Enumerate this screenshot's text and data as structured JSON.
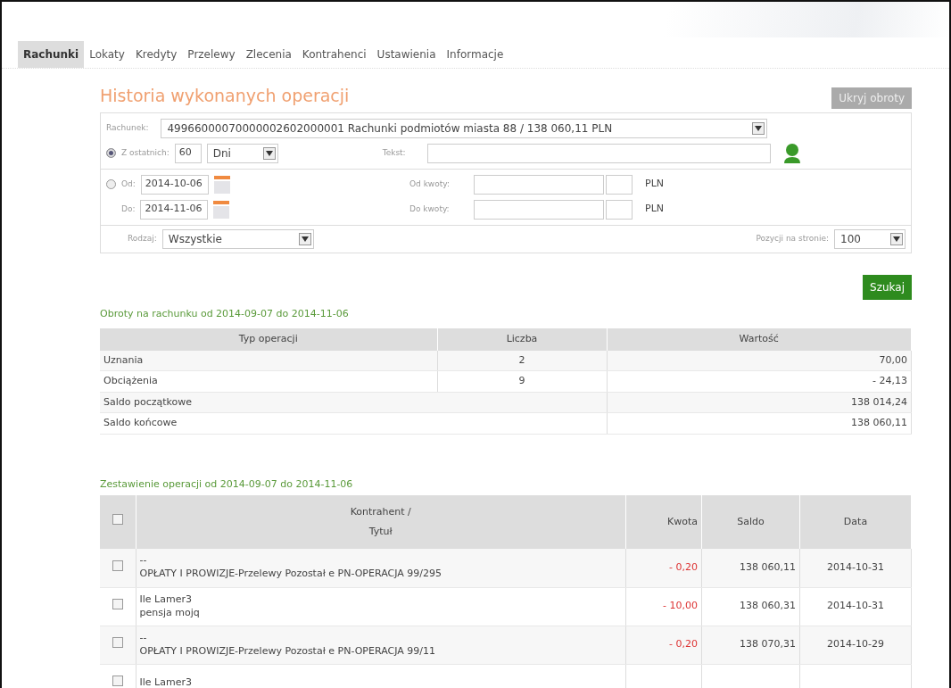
{
  "tabs": [
    {
      "label": "Rachunki",
      "selected": true
    },
    {
      "label": "Lokaty",
      "selected": false
    },
    {
      "label": "Kredyty",
      "selected": false
    },
    {
      "label": "Przelewy",
      "selected": false
    },
    {
      "label": "Zlecenia",
      "selected": false
    },
    {
      "label": "Kontrahenci",
      "selected": false
    },
    {
      "label": "Ustawienia",
      "selected": false
    },
    {
      "label": "Informacje",
      "selected": false
    }
  ],
  "title": "Historia wykonanych operacji",
  "hide_button": "Ukryj obroty",
  "filters": {
    "account": {
      "label": "Rachunek:",
      "value": "49966000070000002602000001 Rachunki podmiotów miasta 88 / 138 060,11 PLN"
    },
    "last_days": {
      "selected": true,
      "label": "Z ostatnich:",
      "value": "60",
      "unit": "Dni"
    },
    "text": {
      "label": "Tekst:"
    },
    "date_range": {
      "selected": false,
      "from_label": "Od:",
      "from": "2014-10-06",
      "to_label": "Do:",
      "to": "2014-11-06"
    },
    "amount_from": {
      "label": "Od kwoty:",
      "currency": "PLN"
    },
    "amount_to": {
      "label": "Do kwoty:",
      "currency": "PLN"
    },
    "type": {
      "label": "Rodzaj:",
      "value": "Wszystkie"
    },
    "per_page": {
      "label": "Pozycji na stronie:",
      "value": "100"
    }
  },
  "search_button": "Szukaj",
  "summary": {
    "title": "Obroty na rachunku od 2014-09-07 do 2014-11-06",
    "columns": [
      "Typ operacji",
      "Liczba",
      "Wartość"
    ],
    "rows": [
      {
        "type": "Uznania",
        "count": "2",
        "value": "70,00"
      },
      {
        "type": "Obciążenia",
        "count": "9",
        "value": "- 24,13"
      },
      {
        "type": "Saldo początkowe",
        "value": "138 014,24"
      },
      {
        "type": "Saldo końcowe",
        "value": "138 060,11"
      }
    ]
  },
  "operations": {
    "title": "Zestawienie operacji od 2014-09-07 do 2014-11-06",
    "select_all_checked": false,
    "columns": [
      "Kontrahent /\nTytuł",
      "Kwota",
      "Saldo",
      "Data"
    ],
    "rows": [
      {
        "checked": false,
        "counterparty": "--",
        "description": "OPŁATY I PROWIZJE-Przelewy Pozostał e PN-OPERACJA 99/295",
        "amount": "- 0,20",
        "balance": "138 060,11",
        "date": "2014-10-31"
      },
      {
        "checked": false,
        "counterparty": "Ile Lamer3",
        "description": "pensja mojq",
        "amount": "- 10,00",
        "balance": "138 060,31",
        "date": "2014-10-31"
      },
      {
        "checked": false,
        "counterparty": "--",
        "description": "OPŁATY I PROWIZJE-Przelewy Pozostał e PN-OPERACJA 99/11",
        "amount": "- 0,20",
        "balance": "138 070,31",
        "date": "2014-10-29"
      },
      {
        "checked": false,
        "counterparty": "Ile Lamer3"
      }
    ]
  }
}
